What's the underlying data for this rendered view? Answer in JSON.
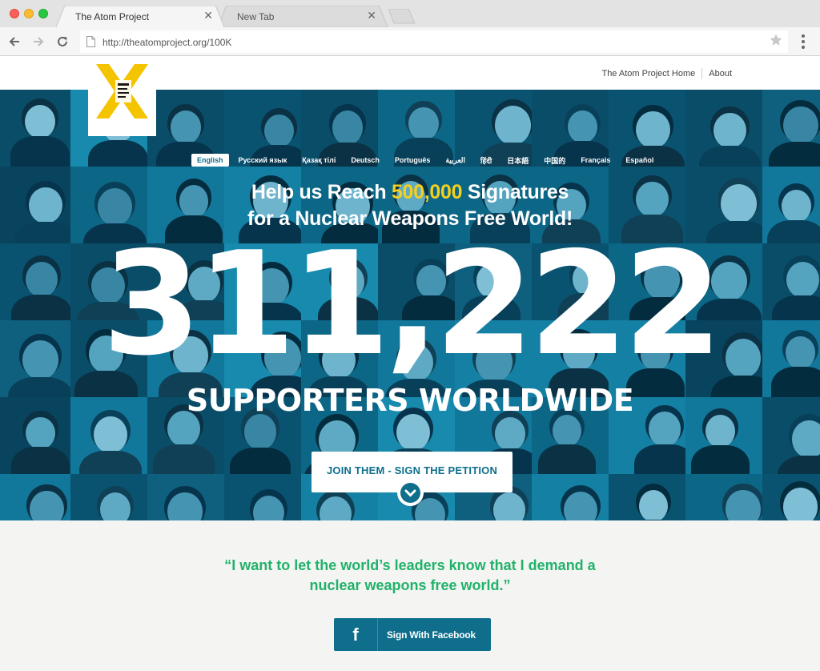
{
  "browser": {
    "tabs": [
      {
        "title": "The Atom Project",
        "active": true
      },
      {
        "title": "New Tab",
        "active": false
      }
    ],
    "url": "http://theatomproject.org/100K"
  },
  "site": {
    "logo_text": "THE ATOM PROJECT",
    "nav": [
      "The Atom Project Home",
      "About"
    ]
  },
  "hero": {
    "languages": [
      "English",
      "Русский язык",
      "Қазақ тілі",
      "Deutsch",
      "Português",
      "العربية",
      "हिंदी",
      "日本語",
      "中国的",
      "Français",
      "Español"
    ],
    "active_language": "English",
    "headline_line1_prefix": "Help us Reach",
    "headline_goal": "500,000",
    "headline_line1_suffix": "Signatures",
    "headline_line2": "for a Nuclear Weapons Free World!",
    "signature_count": "311,222",
    "supporters_label": "SUPPORTERS WORLDWIDE",
    "cta_label": "JOIN THEM - SIGN THE PETITION"
  },
  "lower": {
    "quote_line1": "“I want to let the world’s leaders know that I demand a",
    "quote_line2": "nuclear weapons free world.”",
    "facebook_label": "Sign With Facebook",
    "facebook_icon": "f"
  },
  "colors": {
    "brand_blue": "#0e6e8c",
    "accent_yellow": "#f5cf1e",
    "quote_green": "#21b26a",
    "logo_yellow": "#f5c400"
  }
}
